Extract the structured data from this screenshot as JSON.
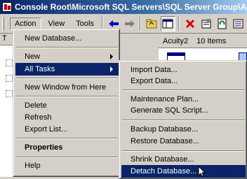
{
  "window": {
    "title": "Console Root\\Microsoft SQL Servers\\SQL Server Group\\A"
  },
  "menubar": {
    "items": [
      {
        "label": "Action"
      },
      {
        "label": "View"
      },
      {
        "label": "Tools"
      }
    ]
  },
  "toolbar": {
    "icons": [
      "back-arrow-icon",
      "forward-arrow-icon",
      "up-folder-icon",
      "show-hide-tree-icon",
      "delete-icon",
      "properties-icon",
      "refresh-icon",
      "export-icon"
    ],
    "colors": {
      "arrow": "#0000c0",
      "delete": "#e00000"
    }
  },
  "right_pane": {
    "server": "Acuity2",
    "count": "10 Items"
  },
  "left_pane": {
    "tab_label": "T"
  },
  "context_menu": {
    "items": [
      {
        "label": "New Database..."
      },
      {
        "label": "New",
        "submenu": true
      },
      {
        "label": "All Tasks",
        "submenu": true,
        "highlighted": true
      },
      {
        "label": "New Window from Here"
      },
      {
        "label": "Delete"
      },
      {
        "label": "Refresh"
      },
      {
        "label": "Export List..."
      },
      {
        "label": "Properties",
        "bold": true
      },
      {
        "label": "Help"
      }
    ]
  },
  "submenu": {
    "items": [
      {
        "label": "Import Data..."
      },
      {
        "label": "Export Data..."
      },
      {
        "label": "Maintenance Plan..."
      },
      {
        "label": "Generate SQL Script..."
      },
      {
        "label": "Backup Database..."
      },
      {
        "label": "Restore Database..."
      },
      {
        "label": "Shrink Database..."
      },
      {
        "label": "Detach Database...",
        "highlighted": true
      }
    ]
  },
  "colors": {
    "highlight": "#0a246a",
    "titlebar_start": "#0a246a",
    "titlebar_end": "#a6caf0",
    "face": "#d4d0c8"
  }
}
